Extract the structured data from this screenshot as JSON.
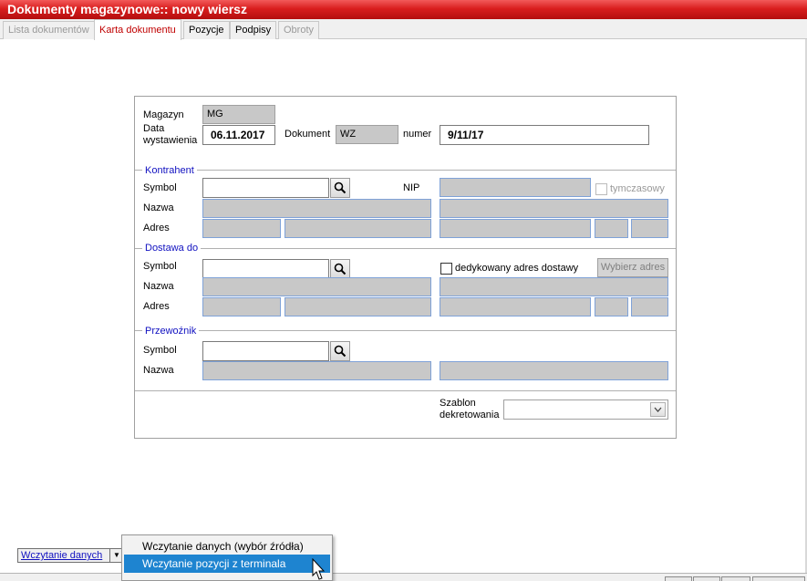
{
  "window": {
    "title": "Dokumenty magazynowe:: nowy wiersz"
  },
  "tabs": {
    "lista": "Lista dokumentów",
    "karta": "Karta dokumentu",
    "pozycje": "Pozycje",
    "podpisy": "Podpisy",
    "obroty": "Obroty"
  },
  "form": {
    "magazyn_label": "Magazyn",
    "magazyn_value": "MG",
    "data_label_1": "Data",
    "data_label_2": "wystawienia",
    "data_value": "06.11.2017",
    "dokument_label": "Dokument",
    "dokument_value": "WZ",
    "numer_label": "numer",
    "numer_value": "9/11/17",
    "kontrahent": {
      "group": "Kontrahent",
      "symbol_label": "Symbol",
      "nazwa_label": "Nazwa",
      "adres_label": "Adres",
      "nip_label": "NIP",
      "tymczasowy_label": "tymczasowy"
    },
    "dostawa": {
      "group": "Dostawa do",
      "symbol_label": "Symbol",
      "nazwa_label": "Nazwa",
      "adres_label": "Adres",
      "dedykowany_label": "dedykowany adres dostawy",
      "wybierz_label": "Wybierz adres"
    },
    "przewoznik": {
      "group": "Przewoźnik",
      "symbol_label": "Symbol",
      "nazwa_label": "Nazwa"
    },
    "szablon_label_1": "Szablon",
    "szablon_label_2": "dekretowania",
    "szablon_value": ""
  },
  "bottom": {
    "wczytanie_button": "Wczytanie danych",
    "menu": [
      "Wczytanie danych (wybór źródła)",
      "Wczytanie pozycji z terminala"
    ]
  },
  "icons": [
    "search-icon",
    "chevron-down-icon",
    "mouse-cursor-icon"
  ],
  "colors": {
    "title_red": "#d91e1e",
    "group_blue": "#1010c0",
    "menu_highlight": "#1e84d0",
    "active_tab": "#c00000"
  }
}
